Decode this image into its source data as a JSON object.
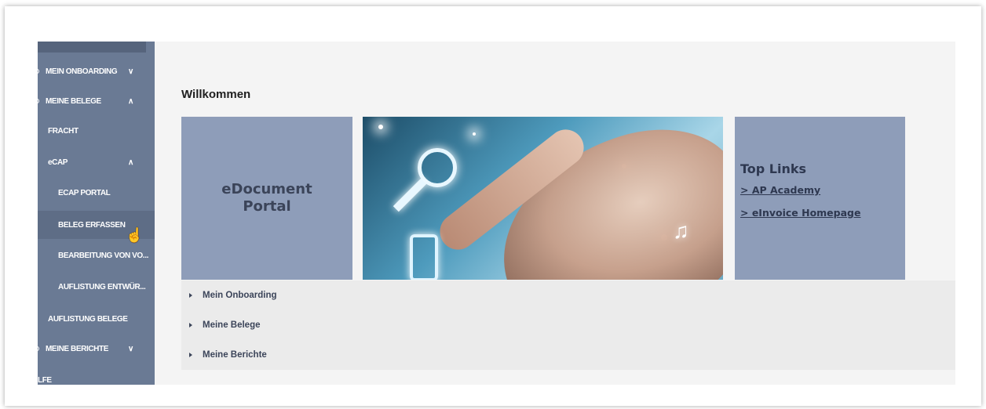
{
  "sidebar": {
    "items": [
      {
        "label": "MEIN ONBOARDING",
        "chevron": "∨"
      },
      {
        "label": "MEINE BELEGE",
        "chevron": "∧"
      },
      {
        "label": "FRACHT"
      },
      {
        "label": "eCAP",
        "chevron": "∧"
      },
      {
        "label": "ECAP PORTAL"
      },
      {
        "label": "BELEG ERFASSEN"
      },
      {
        "label": "BEARBEITUNG VON VO..."
      },
      {
        "label": "AUFLISTUNG ENTWÜR..."
      },
      {
        "label": "AUFLISTUNG BELEGE"
      },
      {
        "label": "MEINE BERICHTE",
        "chevron": "∨"
      },
      {
        "label": "LFE"
      }
    ]
  },
  "main": {
    "title": "Willkommen",
    "portal_tile": {
      "line1": "eDocument",
      "line2": "Portal"
    },
    "links_tile": {
      "heading": "Top Links",
      "links": [
        "> AP Academy",
        "> eInvoice Homepage"
      ]
    },
    "accordion": [
      "Mein Onboarding",
      "Meine Belege",
      "Meine Berichte"
    ]
  },
  "colors": {
    "sidebar_bg": "#6a7a94",
    "tile_bg": "#8e9db9",
    "text_dark": "#2e3850",
    "content_bg": "#f4f4f4"
  }
}
